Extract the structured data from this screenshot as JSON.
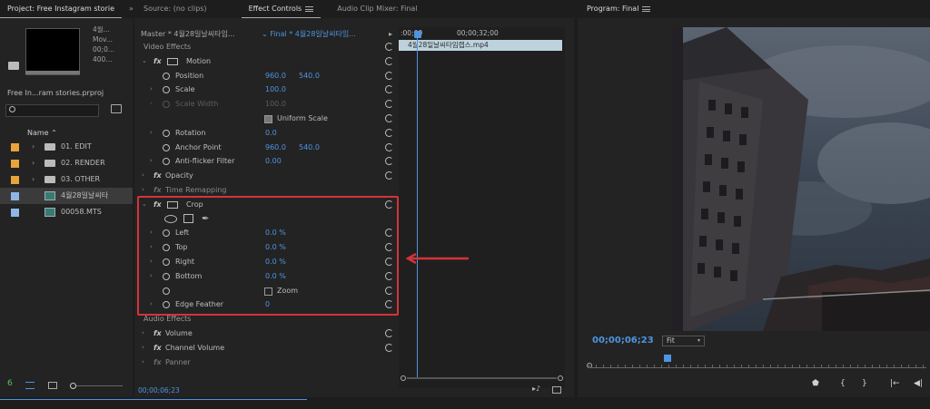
{
  "project": {
    "tab_label": "Project: Free Instagram storie",
    "overflow": "»",
    "clip_meta": [
      "4월...",
      "Mov...",
      "00;0...",
      "400..."
    ],
    "project_file": "Free In...ram stories.prproj",
    "name_header": "Name",
    "items": [
      {
        "label": "01. EDIT",
        "type": "bin",
        "color": "#e8a33b"
      },
      {
        "label": "02. RENDER",
        "type": "bin",
        "color": "#e8a33b"
      },
      {
        "label": "03. OTHER",
        "type": "bin",
        "color": "#e8a33b"
      },
      {
        "label": "4월28일날씨타",
        "type": "sequence",
        "color": "#8fb7e6"
      },
      {
        "label": "00058.MTS",
        "type": "clip",
        "color": "#8fb7e6"
      }
    ]
  },
  "effect_controls": {
    "tabs": [
      "Source: (no clips)",
      "Effect Controls",
      "Audio Clip Mixer: Final"
    ],
    "master": "Master * 4월28일날씨타임...",
    "final": "Final * 4월28일날씨타임...",
    "play_icon": "▸",
    "video_effects_label": "Video Effects",
    "audio_effects_label": "Audio Effects",
    "motion": {
      "name": "Motion",
      "position": {
        "label": "Position",
        "x": "960.0",
        "y": "540.0"
      },
      "scale": {
        "label": "Scale",
        "value": "100.0"
      },
      "scale_width": {
        "label": "Scale Width",
        "value": "100.0"
      },
      "uniform_scale": "Uniform Scale",
      "rotation": {
        "label": "Rotation",
        "value": "0.0"
      },
      "anchor_point": {
        "label": "Anchor Point",
        "x": "960.0",
        "y": "540.0"
      },
      "anti_flicker": {
        "label": "Anti-flicker Filter",
        "value": "0.00"
      }
    },
    "opacity": "Opacity",
    "time_remapping": "Time Remapping",
    "crop": {
      "name": "Crop",
      "left": {
        "label": "Left",
        "value": "0.0 %"
      },
      "top": {
        "label": "Top",
        "value": "0.0 %"
      },
      "right": {
        "label": "Right",
        "value": "0.0 %"
      },
      "bottom": {
        "label": "Bottom",
        "value": "0.0 %"
      },
      "zoom": "Zoom",
      "edge_feather": {
        "label": "Edge Feather",
        "value": "0"
      }
    },
    "volume": "Volume",
    "channel_volume": "Channel Volume",
    "panner": "Panner",
    "timeline_start": ":00;00",
    "timeline_mark": "00;00;32;00",
    "clip_name": "4월28일날씨타임랩스.mp4",
    "footer_timecode": "00;00;06;23"
  },
  "program": {
    "tab_label": "Program: Final",
    "timecode": "00;00;06;23",
    "zoom": "Fit",
    "controls": [
      "⬟",
      "{",
      "}",
      "|←",
      "◀|"
    ]
  },
  "colors": {
    "accent_blue": "#4e94e0",
    "highlight_red": "#d4333a"
  }
}
